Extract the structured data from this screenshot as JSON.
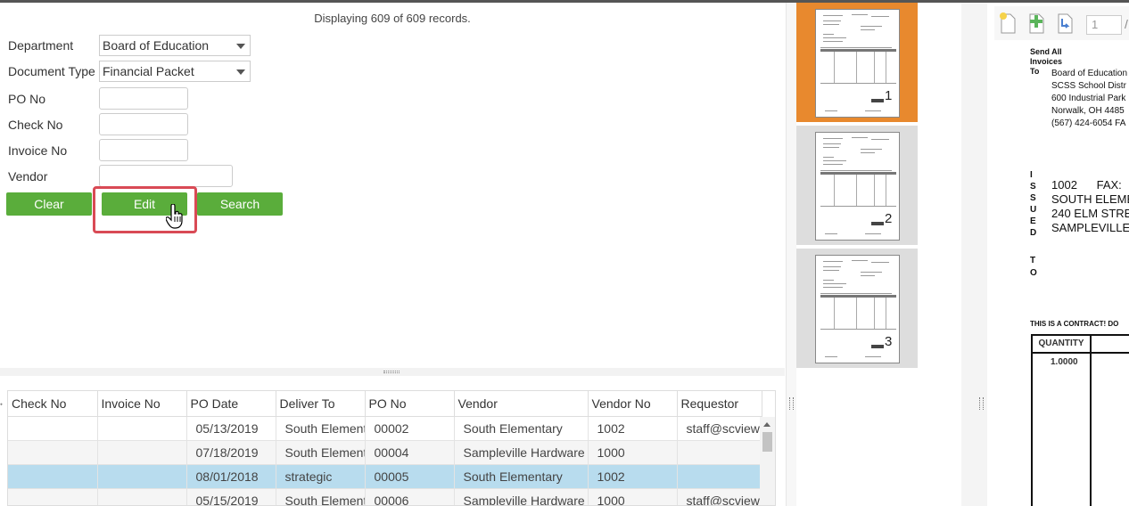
{
  "records_text": "Displaying 609 of 609 records.",
  "form": {
    "department": {
      "label": "Department",
      "value": "Board of Education"
    },
    "document_type": {
      "label": "Document Type",
      "value": "Financial Packet"
    },
    "po_no": {
      "label": "PO No",
      "value": ""
    },
    "check_no": {
      "label": "Check No",
      "value": ""
    },
    "invoice_no": {
      "label": "Invoice No",
      "value": ""
    },
    "vendor": {
      "label": "Vendor",
      "value": ""
    }
  },
  "buttons": {
    "clear": "Clear",
    "edit": "Edit",
    "search": "Search"
  },
  "colors": {
    "button_green": "#5aad3b",
    "highlight_red": "#d94a55",
    "selected_row": "#b8dcee",
    "active_thumb": "#e8892e"
  },
  "grid": {
    "columns": [
      "Check No",
      "Invoice No",
      "PO Date",
      "Deliver To",
      "PO No",
      "Vendor",
      "Vendor No",
      "Requestor"
    ],
    "rows": [
      {
        "check_no": "",
        "invoice_no": "",
        "po_date": "05/13/2019",
        "deliver_to": "South Element",
        "po_no": "00002",
        "vendor": "South Elementary",
        "vendor_no": "1002",
        "requestor": "staff@scview."
      },
      {
        "check_no": "",
        "invoice_no": "",
        "po_date": "07/18/2019",
        "deliver_to": "South Element",
        "po_no": "00004",
        "vendor": "Sampleville Hardware",
        "vendor_no": "1000",
        "requestor": ""
      },
      {
        "check_no": "",
        "invoice_no": "",
        "po_date": "08/01/2018",
        "deliver_to": "strategic",
        "po_no": "00005",
        "vendor": "South Elementary",
        "vendor_no": "1002",
        "requestor": ""
      },
      {
        "check_no": "",
        "invoice_no": "",
        "po_date": "05/15/2019",
        "deliver_to": "South Element",
        "po_no": "00006",
        "vendor": "Sampleville Hardware",
        "vendor_no": "1000",
        "requestor": "staff@scview."
      }
    ]
  },
  "thumbnails": [
    {
      "number": "1"
    },
    {
      "number": "2"
    },
    {
      "number": "3"
    }
  ],
  "viewer": {
    "page_number": "1",
    "page_sep": "/",
    "send_all_1": "Send All",
    "send_all_2": "Invoices",
    "send_all_3": "To",
    "address": [
      "Board of Education",
      "SCSS School Distr",
      "600 Industrial Park",
      "Norwalk, OH 4485",
      "(567) 424-6054 FA"
    ],
    "issued_letters": [
      "I",
      "S",
      "S",
      "U",
      "E",
      "D"
    ],
    "issued_lines": [
      "1002      FAX:",
      "SOUTH ELEME",
      "240 ELM STRE",
      "SAMPLEVILLE"
    ],
    "to_letters": [
      "T",
      "O"
    ],
    "contract_text": "THIS IS A CONTRACT! DO",
    "quantity_header": "QUANTITY",
    "quantity_value": "1.0000"
  }
}
